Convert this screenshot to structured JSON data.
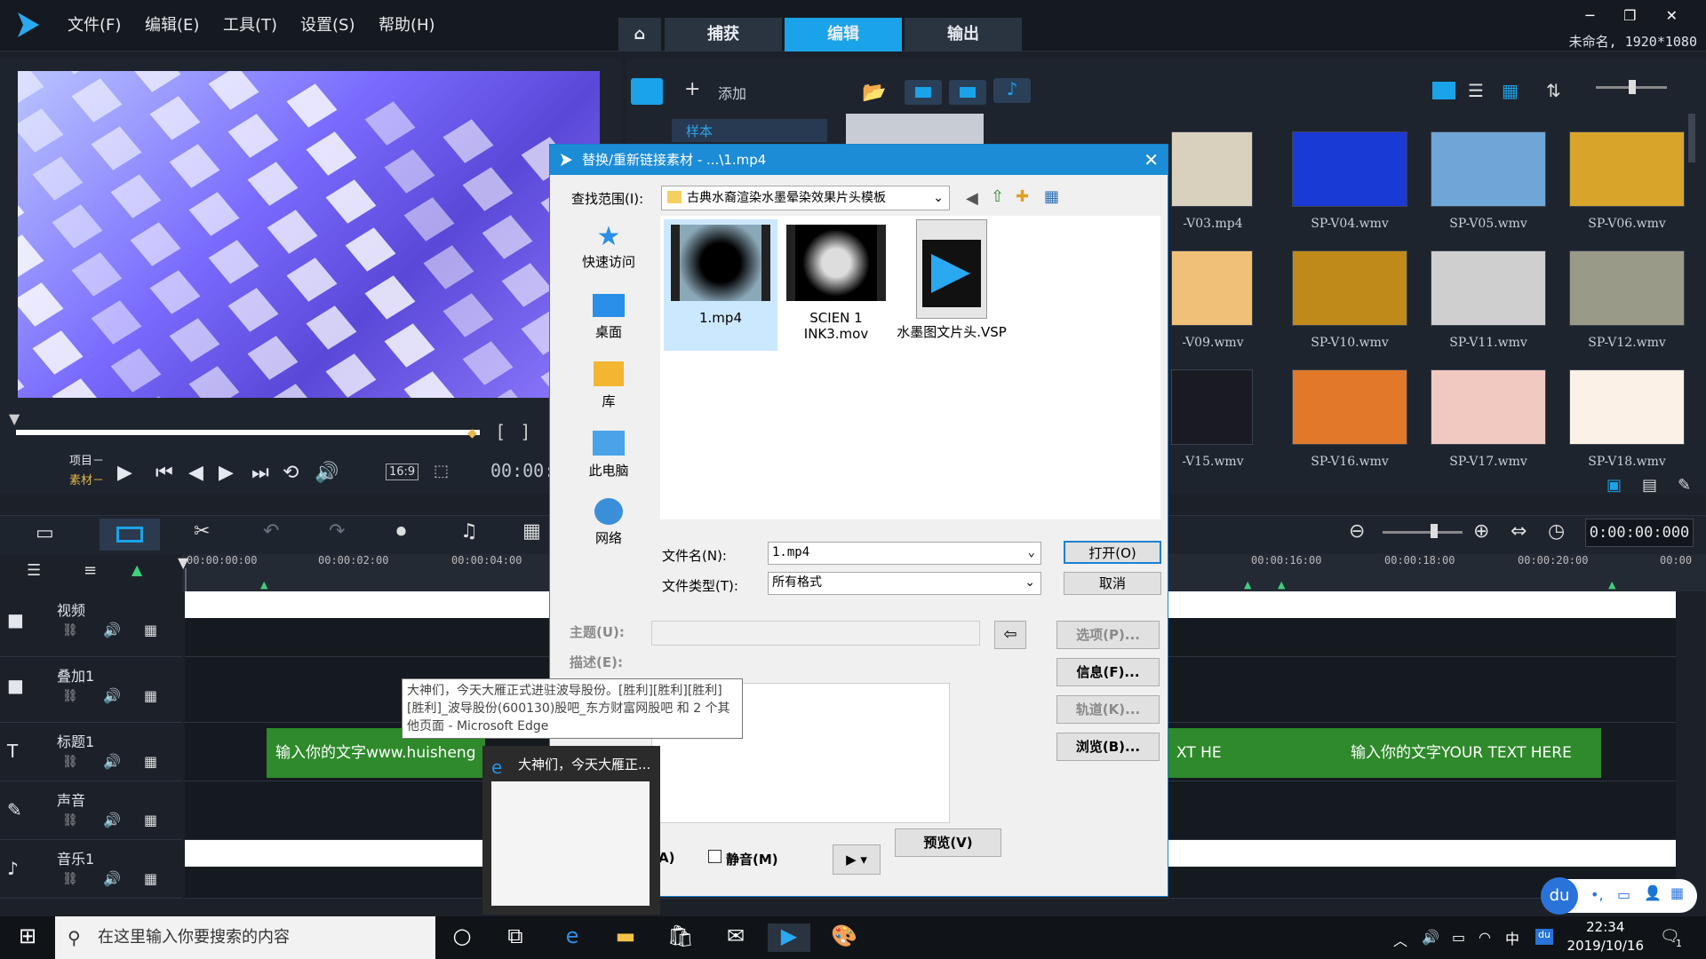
{
  "menubar": {
    "items": [
      "文件(F)",
      "编辑(E)",
      "工具(T)",
      "设置(S)",
      "帮助(H)"
    ]
  },
  "main_tabs": {
    "home_icon": "home-icon",
    "tabs": [
      "捕获",
      "编辑",
      "输出"
    ],
    "active": "编辑"
  },
  "project": {
    "info": "未命名, 1920*1080"
  },
  "preview": {
    "project_label": "项目－",
    "clip_label": "素材－",
    "aspect": "16:9",
    "timecode": "00:00:0"
  },
  "library": {
    "add_label": "添加",
    "sample_label": "样本",
    "thumbs": [
      {
        "label": "-V03.mp4",
        "color": "#d9d0bd"
      },
      {
        "label": "SP-V04.wmv",
        "color": "#1a3ad6"
      },
      {
        "label": "SP-V05.wmv",
        "color": "#6fa6d8"
      },
      {
        "label": "SP-V06.wmv",
        "color": "#d8a52a"
      },
      {
        "label": "-V09.wmv",
        "color": "#f0c078"
      },
      {
        "label": "SP-V10.wmv",
        "color": "#c08a1a"
      },
      {
        "label": "SP-V11.wmv",
        "color": "#cfcfcf"
      },
      {
        "label": "SP-V12.wmv",
        "color": "#9a9a88"
      },
      {
        "label": "-V15.wmv",
        "color": "#1a1a22"
      },
      {
        "label": "SP-V16.wmv",
        "color": "#e07a2a"
      },
      {
        "label": "SP-V17.wmv",
        "color": "#f2c9c0"
      },
      {
        "label": "SP-V18.wmv",
        "color": "#fbf1e6"
      }
    ]
  },
  "timeline": {
    "ruler": [
      "00:00:00:00",
      "00:00:02:00",
      "00:00:04:00",
      "00:00:16:00",
      "00:00:18:00",
      "00:00:20:00",
      "00:00"
    ],
    "timecode": "0:00:00:000",
    "tracks": [
      {
        "name": "视频",
        "icon": "video-track-icon"
      },
      {
        "name": "叠加1",
        "icon": "overlay-track-icon"
      },
      {
        "name": "标题1",
        "icon": "title-track-icon"
      },
      {
        "name": "声音",
        "icon": "voice-track-icon"
      },
      {
        "name": "音乐1",
        "icon": "music-track-icon"
      }
    ],
    "title_clips": [
      "输入你的文字www.huisheng",
      "XT HE",
      "输入你的文字YOUR TEXT HERE"
    ]
  },
  "dialog": {
    "title": "替换/重新链接素材 -   ...\\1.mp4",
    "lookin_label": "查找范围(I):",
    "lookin_value": "古典水裔渲染水墨晕染效果片头模板",
    "places": [
      "快速访问",
      "桌面",
      "库",
      "此电脑",
      "网络"
    ],
    "files": [
      {
        "name": "1.mp4",
        "selected": true
      },
      {
        "name": "SCIEN 1 INK3.mov",
        "selected": false
      },
      {
        "name": "水墨图文片头.VSP",
        "selected": false
      }
    ],
    "filename_label": "文件名(N):",
    "filename_value": "1.mp4",
    "filetype_label": "文件类型(T):",
    "filetype_value": "所有格式",
    "open_button": "打开(O)",
    "cancel_button": "取消",
    "subject_label": "主题(U):",
    "desc_label": "描述(E):",
    "options_button": "选项(P)...",
    "info_button": "信息(F)...",
    "track_button": "轨道(K)...",
    "browse_button": "浏览(B)...",
    "mute_label": "静音(M)",
    "audio_label": "A)",
    "preview_button": "预览(V)"
  },
  "tooltip": {
    "text": "大神们，今天大雁正式进驻波导股份。[胜利][胜利][胜利][胜利]_波导股份(600130)股吧_东方财富网股吧 和 2 个其他页面 - Microsoft Edge"
  },
  "edge_preview": {
    "title": "大神们，今天大雁正..."
  },
  "taskbar": {
    "search_placeholder": "在这里输入你要搜索的内容",
    "time": "22:34",
    "date": "2019/10/16",
    "ime": "中",
    "notification_count": "1"
  }
}
